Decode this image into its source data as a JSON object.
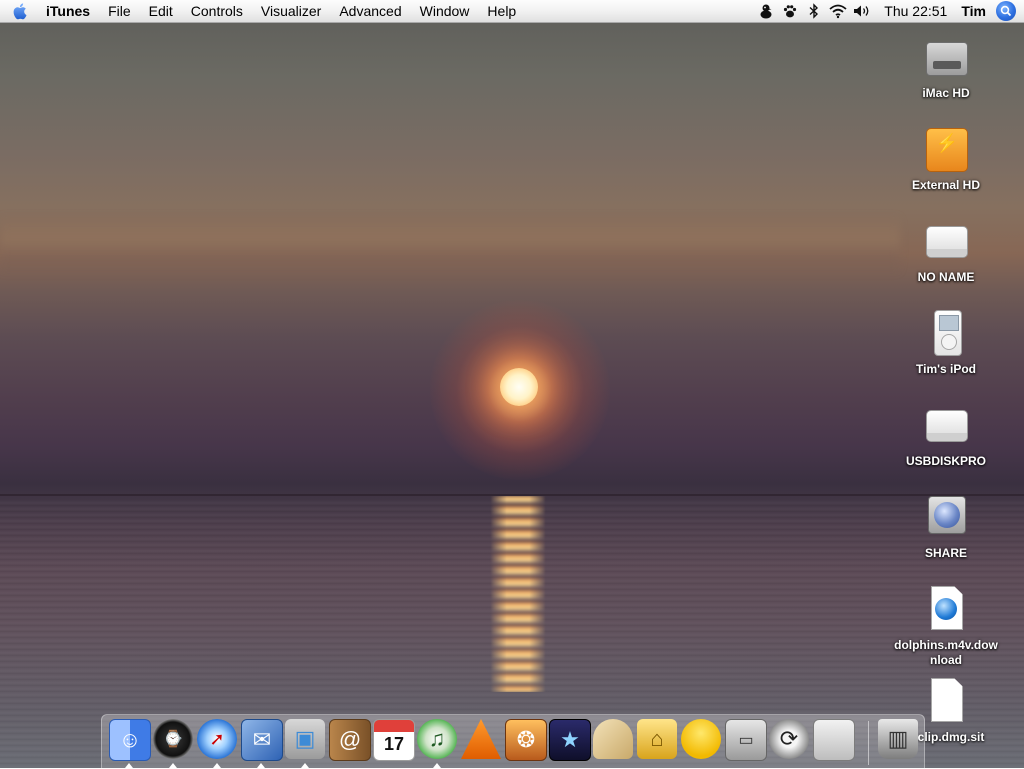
{
  "menubar": {
    "apple_icon": "apple-icon",
    "app_name": "iTunes",
    "menus": [
      "File",
      "Edit",
      "Controls",
      "Visualizer",
      "Advanced",
      "Window",
      "Help"
    ],
    "status_icons": [
      "adium-duck-icon",
      "paw-icon",
      "bluetooth-icon",
      "wifi-icon",
      "volume-icon"
    ],
    "clock": "Thu 22:51",
    "user": "Tim",
    "spotlight_icon": "spotlight-icon"
  },
  "desktop": {
    "wallpaper": "sunset-over-sea",
    "icons": [
      {
        "label": "iMac HD",
        "kind": "hard-drive"
      },
      {
        "label": "External HD",
        "kind": "external-drive"
      },
      {
        "label": "NO NAME",
        "kind": "removable-drive"
      },
      {
        "label": "Tim's iPod",
        "kind": "ipod"
      },
      {
        "label": "USBDISKPRO",
        "kind": "removable-drive"
      },
      {
        "label": "SHARE",
        "kind": "network-volume"
      },
      {
        "label": "dolphins.m4v.download",
        "kind": "download-file"
      },
      {
        "label": "ll clip.dmg.sit",
        "kind": "document"
      }
    ]
  },
  "dock": {
    "apps": [
      {
        "name": "Finder",
        "icon": "finder-icon",
        "running": true
      },
      {
        "name": "Dashboard",
        "icon": "dashboard-icon",
        "running": true
      },
      {
        "name": "Safari",
        "icon": "safari-icon",
        "running": true
      },
      {
        "name": "Mail",
        "icon": "mail-icon",
        "running": true
      },
      {
        "name": "iChat",
        "icon": "ichat-icon",
        "running": true
      },
      {
        "name": "Address Book",
        "icon": "address-book-icon",
        "running": false
      },
      {
        "name": "iCal",
        "icon": "ical-icon",
        "running": false,
        "badge": "17"
      },
      {
        "name": "iTunes",
        "icon": "itunes-icon",
        "running": true
      },
      {
        "name": "VLC",
        "icon": "vlc-icon",
        "running": false
      },
      {
        "name": "iPhoto",
        "icon": "iphoto-icon",
        "running": false
      },
      {
        "name": "iMovie",
        "icon": "imovie-icon",
        "running": false
      },
      {
        "name": "Taco HTML Edit",
        "icon": "taco-icon",
        "running": false
      },
      {
        "name": "Keychain Access",
        "icon": "lock-icon",
        "running": false
      },
      {
        "name": "Cyberduck",
        "icon": "duck-icon",
        "running": false
      },
      {
        "name": "Disk Utility",
        "icon": "disk-utility-icon",
        "running": false
      },
      {
        "name": "iSync",
        "icon": "sync-icon",
        "running": false
      },
      {
        "name": "System Preferences",
        "icon": "system-preferences-icon",
        "running": false
      }
    ],
    "trash_icon": "trash-icon"
  }
}
